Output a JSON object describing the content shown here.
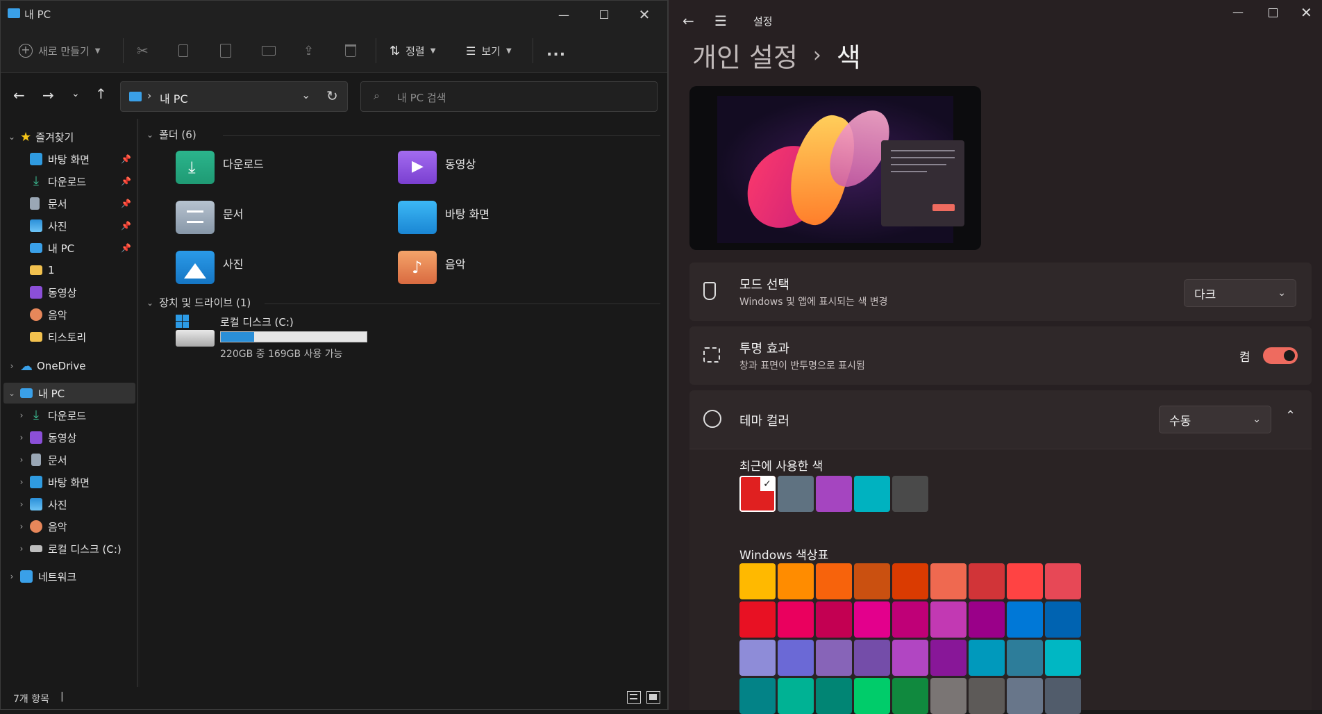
{
  "explorer": {
    "title": "내 PC",
    "toolbar": {
      "new_label": "새로 만들기",
      "sort_label": "정렬",
      "view_label": "보기",
      "more_label": "..."
    },
    "address": {
      "path": "내 PC",
      "search_placeholder": "내 PC 검색"
    },
    "nav": {
      "quick_access": "즐겨찾기",
      "quick_items": [
        "바탕 화면",
        "다운로드",
        "문서",
        "사진",
        "내 PC",
        "1",
        "동영상",
        "음악",
        "티스토리"
      ],
      "onedrive": "OneDrive",
      "this_pc": "내 PC",
      "this_pc_items": [
        "다운로드",
        "동영상",
        "문서",
        "바탕 화면",
        "사진",
        "음악",
        "로컬 디스크 (C:)"
      ],
      "network": "네트워크"
    },
    "content": {
      "folders_header": "폴더 (6)",
      "folders": [
        "다운로드",
        "동영상",
        "문서",
        "바탕 화면",
        "사진",
        "음악"
      ],
      "drives_header": "장치 및 드라이브 (1)",
      "drive_name": "로컬 디스크 (C:)",
      "drive_info": "220GB 중 169GB 사용 가능",
      "drive_used_fraction": 0.23
    },
    "status": {
      "item_count": "7개 항목"
    }
  },
  "settings": {
    "title": "설정",
    "breadcrumb_parent": "개인 설정",
    "breadcrumb_sep": "›",
    "breadcrumb_current": "색",
    "mode": {
      "title": "모드 선택",
      "subtitle": "Windows 및 앱에 표시되는 색 변경",
      "value": "다크"
    },
    "transparency": {
      "title": "투명 효과",
      "subtitle": "창과 표면이 반투명으로 표시됨",
      "state_label": "켬",
      "on": true
    },
    "accent": {
      "title": "테마 컬러",
      "value": "수동",
      "recent_label": "최근에 사용한 색",
      "recent_colors": [
        "#e02020",
        "#5f7281",
        "#a545c0",
        "#00b2c0",
        "#4a4a4a"
      ],
      "palette_label": "Windows 색상표",
      "palette": [
        [
          "#ffb900",
          "#ff8c00",
          "#f7630c",
          "#ca5010",
          "#da3b01",
          "#ef6950",
          "#d13438",
          "#ff4343",
          "#e74856"
        ],
        [
          "#e81123",
          "#ea005e",
          "#c30052",
          "#e3008c",
          "#bf0077",
          "#c239b3",
          "#9a0089",
          "#0078d7",
          "#0063b1"
        ],
        [
          "#8e8cd8",
          "#6b69d6",
          "#8764b8",
          "#744da9",
          "#b146c2",
          "#881798",
          "#0099bc",
          "#2d7d9a",
          "#00b7c3"
        ],
        [
          "#038387",
          "#00b294",
          "#018574",
          "#00cc6a",
          "#10893e",
          "#7a7574",
          "#5d5a58",
          "#68768a",
          "#515c6b"
        ]
      ]
    }
  }
}
